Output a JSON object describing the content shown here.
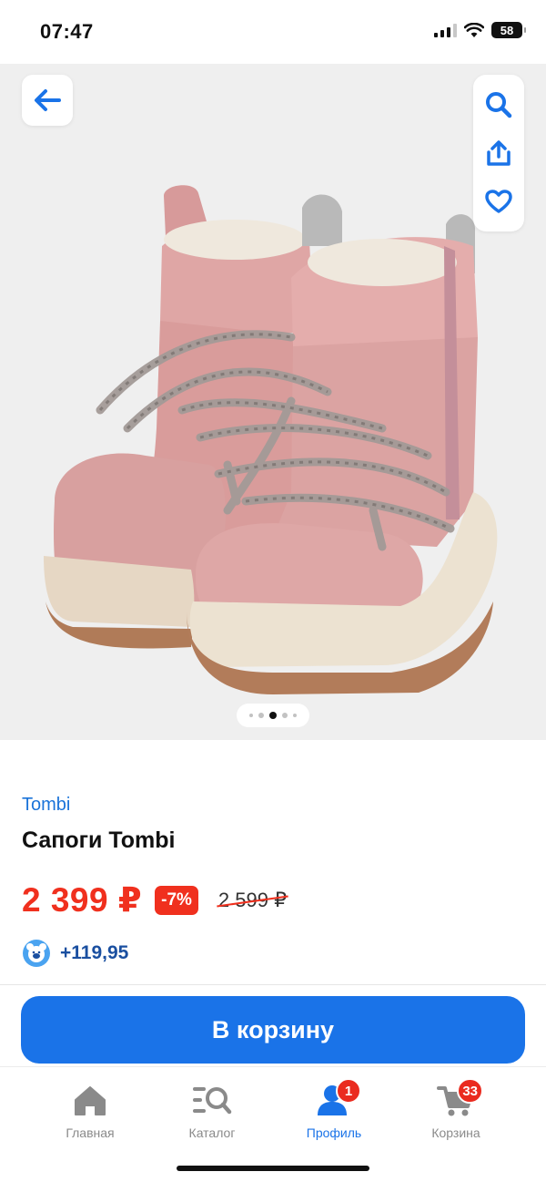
{
  "status": {
    "time": "07:47",
    "battery": "58"
  },
  "gallery": {
    "image_alt": "Pink winter boots with grey laces"
  },
  "product": {
    "brand": "Tombi",
    "title": "Сапоги Tombi",
    "price": "2 399 ₽",
    "discount": "-7%",
    "old_price": "2 599 ₽",
    "bonus": "+119,95"
  },
  "actions": {
    "add_to_cart": "В корзину"
  },
  "tabs": [
    {
      "label": "Главная",
      "icon": "home-icon"
    },
    {
      "label": "Каталог",
      "icon": "catalog-search-icon"
    },
    {
      "label": "Профиль",
      "icon": "profile-icon",
      "badge": "1",
      "active": true
    },
    {
      "label": "Корзина",
      "icon": "cart-icon",
      "badge": "33"
    }
  ],
  "colors": {
    "accent": "#1a73e8",
    "price": "#f0301e",
    "badge": "#ea2b1f",
    "gallery_bg": "#efefef"
  }
}
